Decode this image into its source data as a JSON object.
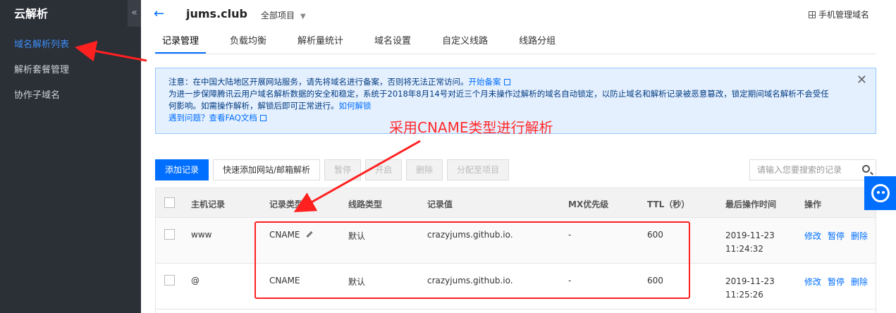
{
  "sidebar": {
    "title": "云解析",
    "collapse_icon": "«",
    "items": [
      {
        "label": "域名解析列表",
        "active": true
      },
      {
        "label": "解析套餐管理",
        "active": false
      },
      {
        "label": "协作子域名",
        "active": false
      }
    ]
  },
  "header": {
    "back_icon": "←",
    "domain": "jums.club",
    "project": "全部项目",
    "mobile_label": "手机管理域名"
  },
  "tabs": [
    "记录管理",
    "负载均衡",
    "解析量统计",
    "域名设置",
    "自定义线路",
    "线路分组"
  ],
  "notice": {
    "line1_text": "注意：在中国大陆地区开展网站服务，请先将域名进行备案，否则将无法正常访问。",
    "line1_link": "开始备案",
    "line2_text": "为进一步保障腾讯云用户域名解析数据的安全和稳定，系统于2018年8月14号对近三个月未操作过解析的域名自动锁定，以防止域名和解析记录被恶意篡改，锁定期间域名解析不会受任",
    "line3_text": "何影响。如需操作解析，解锁后即可正常进行。",
    "line3_link": "如何解锁",
    "line4_link": "遇到问题？查看FAQ文档",
    "close_icon": "✕"
  },
  "annotation": "采用CNAME类型进行解析",
  "toolbar": {
    "add": "添加记录",
    "quick": "快速添加网站/邮箱解析",
    "pause": "暂停",
    "start": "开启",
    "delete": "删除",
    "assign": "分配至项目",
    "search_placeholder": "请输入您要搜索的记录"
  },
  "table": {
    "headers": [
      "主机记录",
      "记录类型",
      "线路类型",
      "记录值",
      "MX优先级",
      "TTL（秒）",
      "最后操作时间",
      "操作"
    ],
    "rows": [
      {
        "host": "www",
        "type": "CNAME",
        "line": "默认",
        "value": "crazyjums.github.io.",
        "mx": "-",
        "ttl": "600",
        "date": "2019-11-23",
        "time": "11:24:32"
      },
      {
        "host": "@",
        "type": "CNAME",
        "line": "默认",
        "value": "crazyjums.github.io.",
        "mx": "-",
        "ttl": "600",
        "date": "2019-11-23",
        "time": "11:25:26"
      }
    ],
    "actions": [
      "修改",
      "暂停",
      "删除"
    ]
  },
  "colors": {
    "accent": "#006eff",
    "annotation": "#ff2b2b",
    "sidebar_bg": "#2b2f36"
  }
}
